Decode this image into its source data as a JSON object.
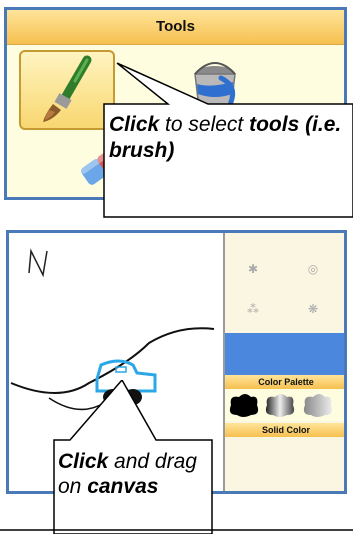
{
  "tools_panel": {
    "title": "Tools",
    "tools": [
      {
        "name": "brush",
        "icon": "paintbrush-icon",
        "selected": true
      },
      {
        "name": "fill",
        "icon": "paint-bucket-icon",
        "selected": false
      },
      {
        "name": "eraser",
        "icon": "eraser-icon",
        "selected": false
      }
    ]
  },
  "callout_tools": {
    "word_click": "Click",
    "text_mid": " to select ",
    "word_tools": "tools (i.e. brush)"
  },
  "canvas_panel": {
    "drawn_letter": "N",
    "palette_header": "Color Palette",
    "solid_header": "Solid Color"
  },
  "callout_canvas": {
    "word_click": "Click",
    "text_mid": " and drag on ",
    "word_canvas": "canvas"
  },
  "colors": {
    "border": "#4a79b8",
    "header_gold": "#f6c04f",
    "panel_cream": "#fffde0",
    "blue_band": "#4a87dd"
  }
}
